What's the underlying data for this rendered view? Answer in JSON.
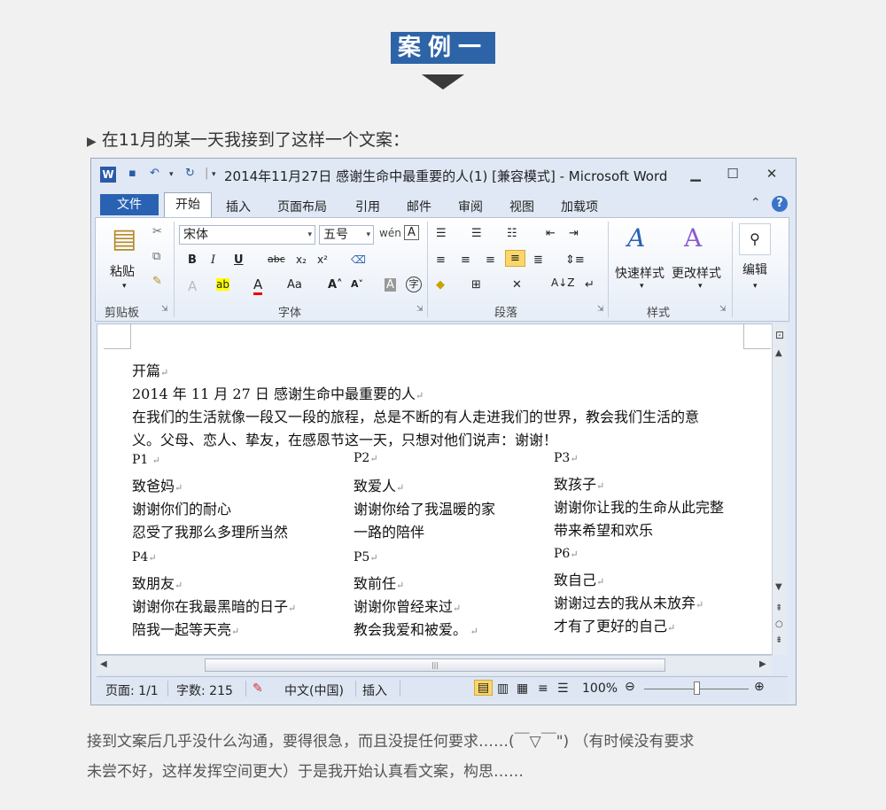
{
  "badge": "案例一",
  "intro": "在11月的某一天我接到了这样一个文案：",
  "window": {
    "title": "2014年11月27日 感谢生命中最重要的人(1) [兼容模式] - Microsoft Word",
    "app_icon": "W"
  },
  "tabs": {
    "file": "文件",
    "items": [
      "开始",
      "插入",
      "页面布局",
      "引用",
      "邮件",
      "审阅",
      "视图",
      "加载项"
    ]
  },
  "ribbon": {
    "clipboard": {
      "paste": "粘贴",
      "label": "剪贴板"
    },
    "font": {
      "name": "宋体",
      "size": "五号",
      "label": "字体"
    },
    "paragraph": {
      "label": "段落"
    },
    "styles": {
      "quick": "快速样式",
      "change": "更改样式",
      "label": "样式"
    },
    "editing": {
      "label": "编辑"
    }
  },
  "document": {
    "line1": "开篇",
    "line2": "2014 年 11 月 27 日  感谢生命中最重要的人",
    "line3": "在我们的生活就像一段又一段的旅程，总是不断的有人走进我们的世界，教会我们生活的意",
    "line4": "义。父母、恋人、挚友，在感恩节这一天，只想对他们说声：谢谢！",
    "cols": [
      {
        "p": "P1",
        "l1": "致爸妈",
        "l2": "谢谢你们的耐心",
        "l3": "忍受了我那么多理所当然"
      },
      {
        "p": "P2",
        "l1": "致爱人",
        "l2": "谢谢你给了我温暖的家",
        "l3": "一路的陪伴"
      },
      {
        "p": "P3",
        "l1": "致孩子",
        "l2": "谢谢你让我的生命从此完整",
        "l3": "带来希望和欢乐"
      },
      {
        "p": "P4",
        "l1": "致朋友",
        "l2": "谢谢你在我最黑暗的日子",
        "l3": "陪我一起等天亮"
      },
      {
        "p": "P5",
        "l1": "致前任",
        "l2": "谢谢你曾经来过",
        "l3": "教会我爱和被爱。"
      },
      {
        "p": "P6",
        "l1": "致自己",
        "l2": "谢谢过去的我从未放弃",
        "l3": "才有了更好的自己"
      }
    ]
  },
  "status": {
    "page": "页面: 1/1",
    "words": "字数: 215",
    "lang": "中文(中国)",
    "mode": "插入",
    "zoom": "100%"
  },
  "outro": {
    "line1": "接到文案后几乎没什么沟通，要得很急，而且没提任何要求……(￣▽￣\") （有时候没有要求",
    "line2": "未尝不好，这样发挥空间更大）于是我开始认真看文案，构思……"
  }
}
